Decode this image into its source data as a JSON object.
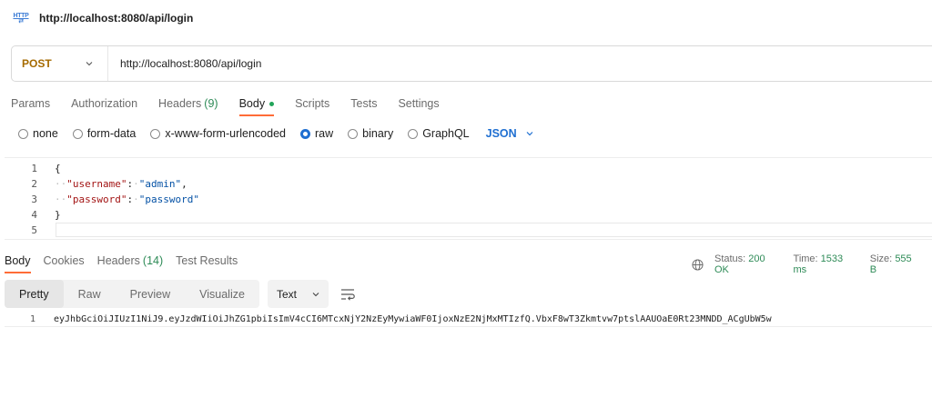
{
  "titlebar": {
    "icon": "http-icon",
    "icon_text": "HTTP",
    "title": "http://localhost:8080/api/login"
  },
  "request": {
    "method": "POST",
    "url": "http://localhost:8080/api/login",
    "tabs": [
      {
        "label": "Params"
      },
      {
        "label": "Authorization"
      },
      {
        "label": "Headers",
        "count": "(9)"
      },
      {
        "label": "Body",
        "active": true,
        "indicator": "green-dot"
      },
      {
        "label": "Scripts"
      },
      {
        "label": "Tests"
      },
      {
        "label": "Settings"
      }
    ],
    "body_types": [
      "none",
      "form-data",
      "x-www-form-urlencoded",
      "raw",
      "binary",
      "GraphQL"
    ],
    "body_type_selected": "raw",
    "language": "JSON",
    "body_lines": [
      {
        "num": "1",
        "text": "{"
      },
      {
        "num": "2",
        "key": "\"username\"",
        "value": "\"admin\""
      },
      {
        "num": "3",
        "key": "\"password\"",
        "value": "\"password\""
      },
      {
        "num": "4",
        "text": "}"
      },
      {
        "num": "5",
        "text": ""
      }
    ]
  },
  "response": {
    "tabs": [
      {
        "label": "Body",
        "active": true
      },
      {
        "label": "Cookies"
      },
      {
        "label": "Headers",
        "count": "(14)"
      },
      {
        "label": "Test Results"
      }
    ],
    "status_label": "Status:",
    "status_value": "200 OK",
    "time_label": "Time:",
    "time_value": "1533 ms",
    "size_label": "Size:",
    "size_value": "555 B",
    "view_modes": [
      "Pretty",
      "Raw",
      "Preview",
      "Visualize"
    ],
    "view_selected": "Pretty",
    "format": "Text",
    "lines": [
      {
        "num": "1",
        "text": "eyJhbGciOiJIUzI1NiJ9.eyJzdWIiOiJhZG1pbiIsImV4cCI6MTcxNjY2NzEyMywiaWF0IjoxNzE2NjMxMTIzfQ.VbxF8wT3Zkmtvw7ptslAAUOaE0Rt23MNDD_ACgUbW5w"
      }
    ]
  },
  "colors": {
    "method": "#a56a00",
    "accent": "#ff6c37",
    "link": "#1f6fd1",
    "success": "#2e8b57"
  }
}
